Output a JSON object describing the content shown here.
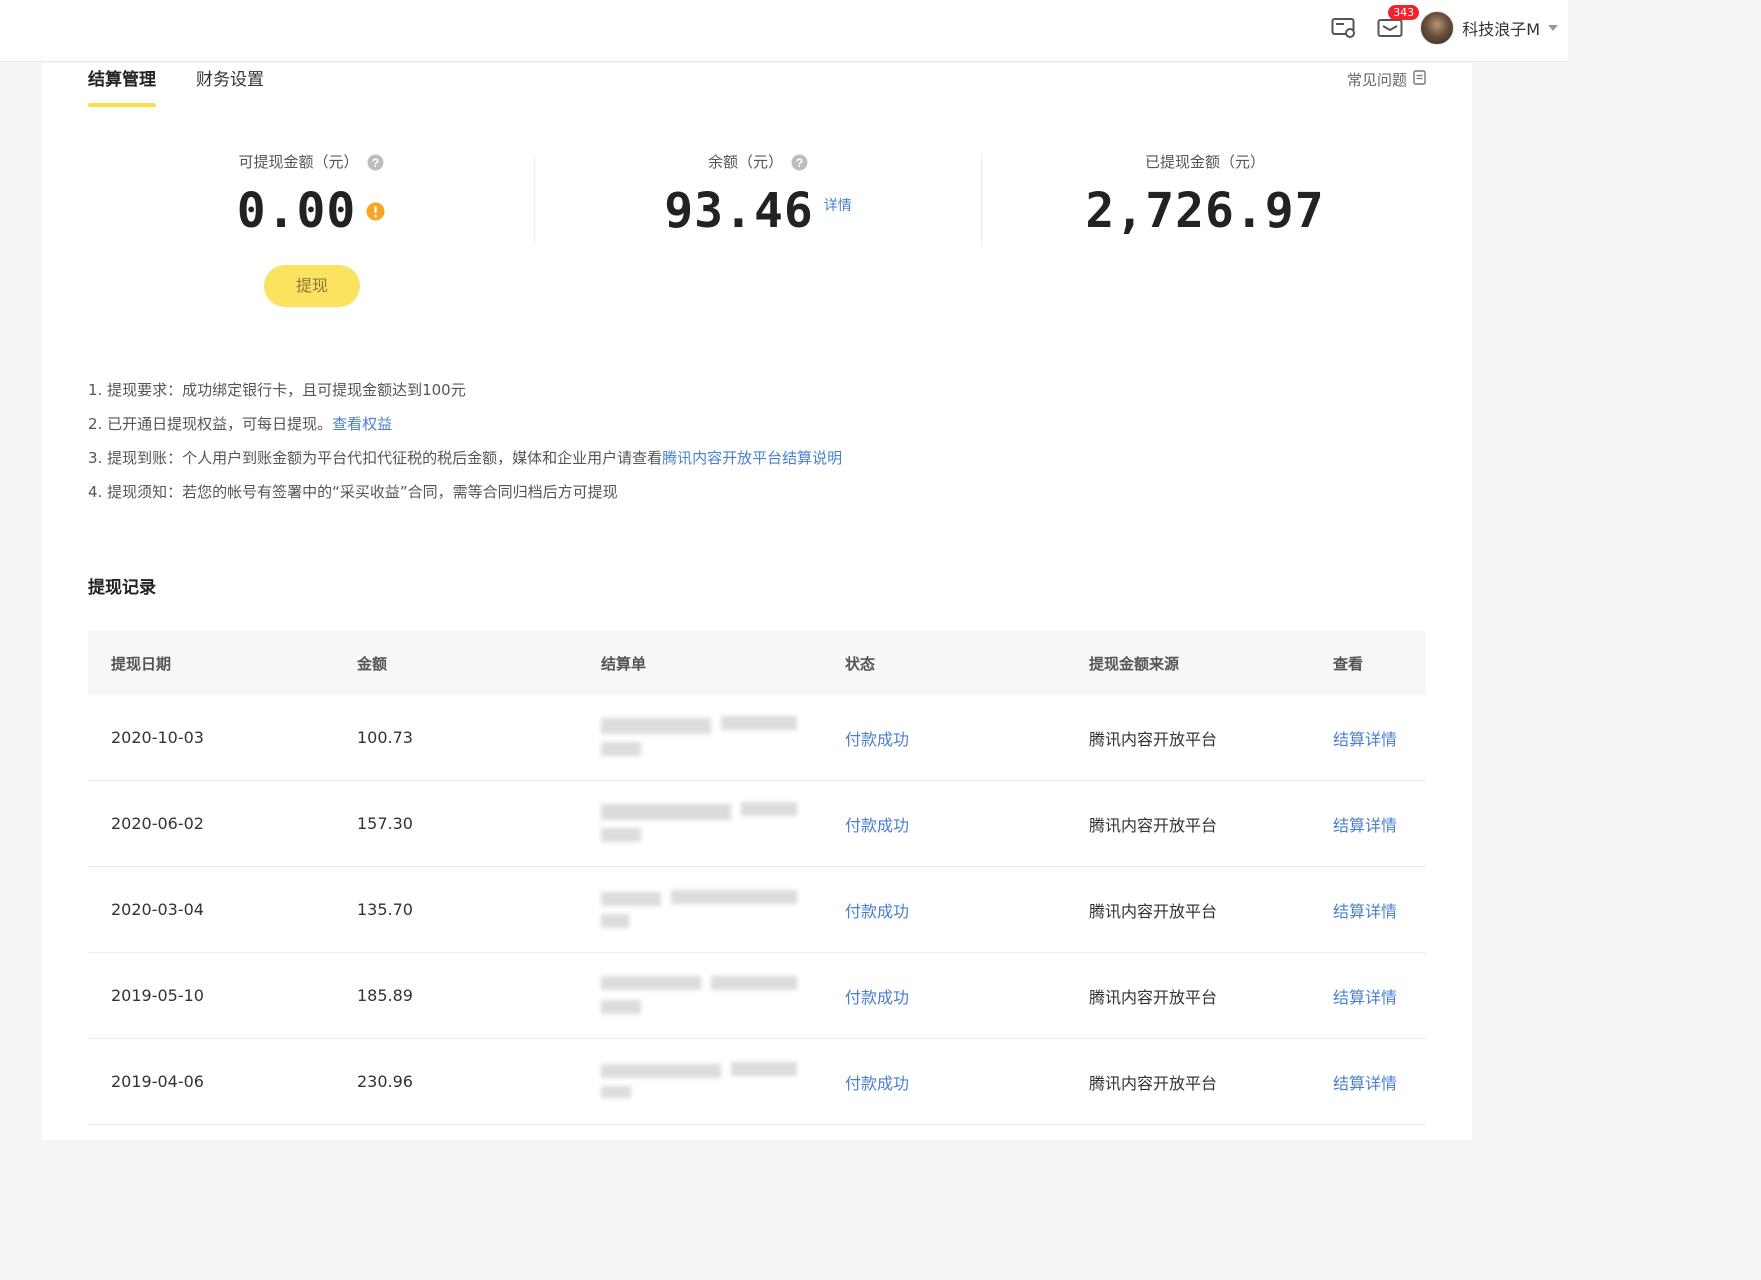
{
  "header": {
    "badge_count": "343",
    "username": "科技浪子M",
    "icons": [
      "screen-settings-icon",
      "mail-icon",
      "avatar",
      "chevron-down-icon"
    ]
  },
  "tabs": [
    {
      "label": "结算管理",
      "active": true
    },
    {
      "label": "财务设置",
      "active": false
    }
  ],
  "faq_label": "常见问题",
  "stats": {
    "withdrawable": {
      "label": "可提现金额（元）",
      "value": "0.00"
    },
    "balance": {
      "label": "余额（元）",
      "value": "93.46",
      "detail_label": "详情"
    },
    "withdrawn": {
      "label": "已提现金额（元）",
      "value": "2,726.97"
    }
  },
  "withdraw_button": "提现",
  "notes": [
    {
      "text": "1. 提现要求：成功绑定银行卡，且可提现金额达到100元",
      "link": ""
    },
    {
      "text": "2. 已开通日提现权益，可每日提现。",
      "link": "查看权益"
    },
    {
      "text": "3. 提现到账：个人用户到账金额为平台代扣代征税的税后金额，媒体和企业用户请查看",
      "link": "腾讯内容开放平台结算说明"
    },
    {
      "text": "4. 提现须知：若您的帐号有签署中的“采买收益”合同，需等合同归档后方可提现",
      "link": ""
    }
  ],
  "records_title": "提现记录",
  "table": {
    "headers": [
      "提现日期",
      "金额",
      "结算单",
      "状态",
      "提现金额来源",
      "查看"
    ],
    "rows": [
      {
        "date": "2020-10-03",
        "amount": "100.73",
        "status": "付款成功",
        "source": "腾讯内容开放平台",
        "action": "结算详情"
      },
      {
        "date": "2020-06-02",
        "amount": "157.30",
        "status": "付款成功",
        "source": "腾讯内容开放平台",
        "action": "结算详情"
      },
      {
        "date": "2020-03-04",
        "amount": "135.70",
        "status": "付款成功",
        "source": "腾讯内容开放平台",
        "action": "结算详情"
      },
      {
        "date": "2019-05-10",
        "amount": "185.89",
        "status": "付款成功",
        "source": "腾讯内容开放平台",
        "action": "结算详情"
      },
      {
        "date": "2019-04-06",
        "amount": "230.96",
        "status": "付款成功",
        "source": "腾讯内容开放平台",
        "action": "结算详情"
      }
    ]
  },
  "colors": {
    "accent_yellow": "#fce045",
    "link_blue": "#4a7fd0",
    "badge_red": "#f5222d",
    "warn_orange": "#f5a623"
  }
}
